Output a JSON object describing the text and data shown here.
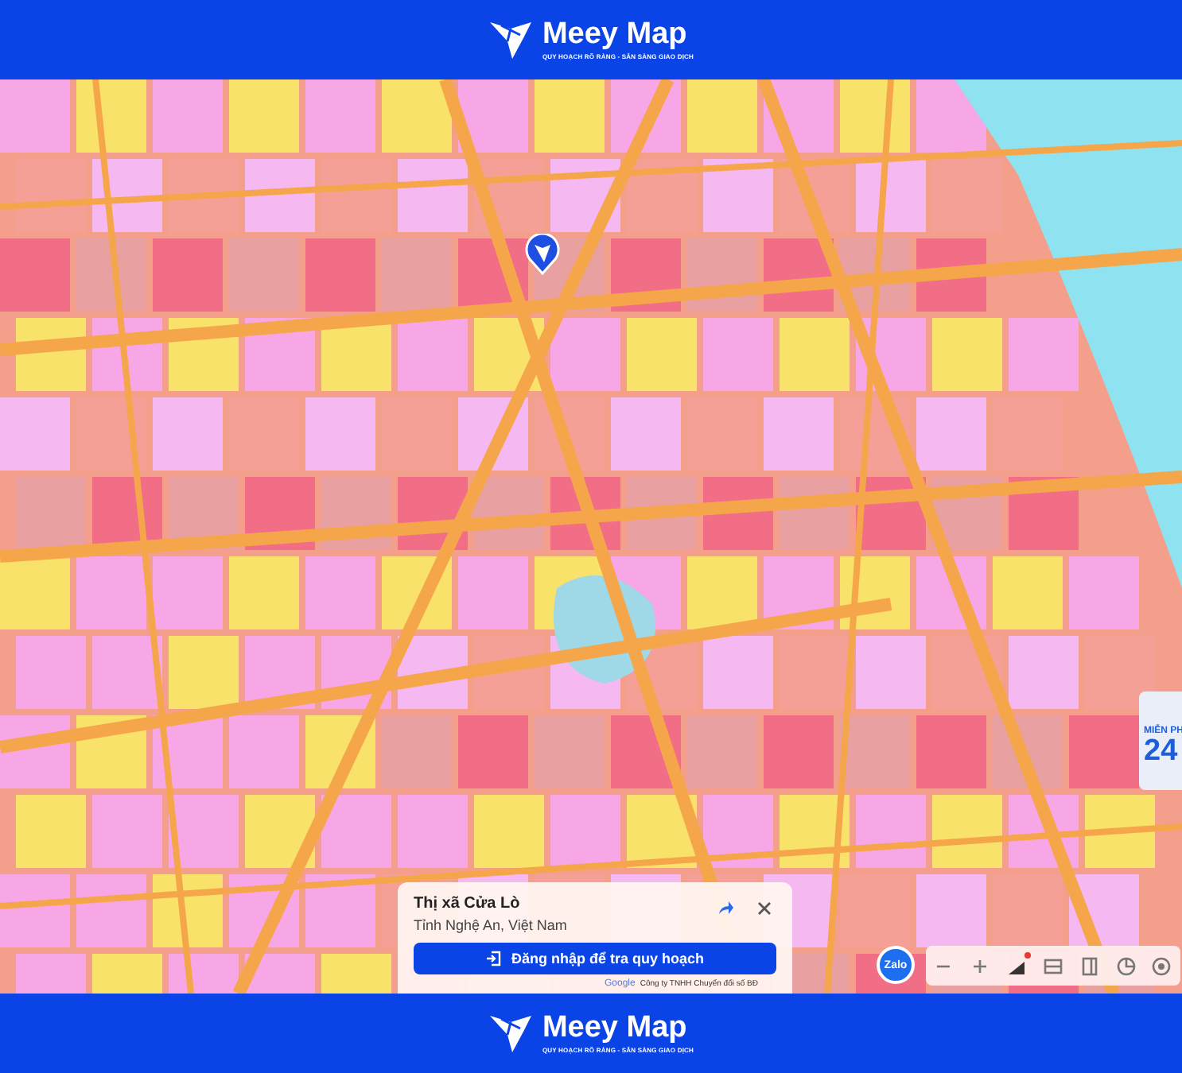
{
  "header": {
    "brand": "Meey Map",
    "tagline": "QUY HOẠCH RÕ RÀNG - SẴN SÀNG GIAO DỊCH"
  },
  "place_card": {
    "title": "Thị xã Cửa Lò",
    "subtitle": "Tỉnh Nghệ An, Việt Nam",
    "login_button": "Đăng nhập để tra quy hoạch"
  },
  "attribution": {
    "provider": "Google",
    "owner": "Công ty TNHH Chuyển đổi số BĐ"
  },
  "chat_button": "Zalo",
  "promo": {
    "caption": "MIỄN PH",
    "number": "24"
  },
  "toolbar": [
    {
      "kind": "zoom-out"
    },
    {
      "kind": "zoom-in"
    },
    {
      "kind": "layers",
      "badge": true
    },
    {
      "kind": "split"
    },
    {
      "kind": "panel"
    },
    {
      "kind": "chart"
    },
    {
      "kind": "locate"
    }
  ],
  "footer": {
    "brand": "Meey Map",
    "tagline": "QUY HOẠCH RÕ RÀNG - SẴN SÀNG GIAO DỊCH"
  }
}
